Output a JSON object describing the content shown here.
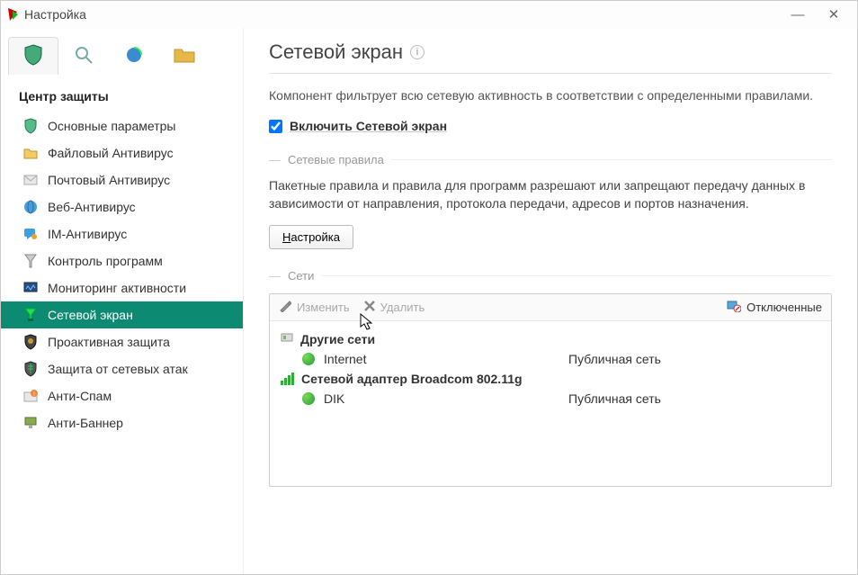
{
  "window": {
    "title": "Настройка"
  },
  "sidebar": {
    "section_title": "Центр защиты",
    "items": [
      {
        "label": "Основные параметры"
      },
      {
        "label": "Файловый Антивирус"
      },
      {
        "label": "Почтовый Антивирус"
      },
      {
        "label": "Веб-Антивирус"
      },
      {
        "label": "IM-Антивирус"
      },
      {
        "label": "Контроль программ"
      },
      {
        "label": "Мониторинг активности"
      },
      {
        "label": "Сетевой экран"
      },
      {
        "label": "Проактивная защита"
      },
      {
        "label": "Защита от сетевых атак"
      },
      {
        "label": "Анти-Спам"
      },
      {
        "label": "Анти-Баннер"
      }
    ]
  },
  "main": {
    "title": "Сетевой экран",
    "description": "Компонент фильтрует всю сетевую активность в соответствии с определенными правилами.",
    "enable_label": "Включить Сетевой экран",
    "rules_section": "Сетевые правила",
    "rules_description": "Пакетные правила и правила для программ разрешают или запрещают передачу данных в зависимости от направления, протокола передачи, адресов и портов назначения.",
    "settings_btn_prefix": "Н",
    "settings_btn_rest": "астройка",
    "networks_section": "Сети",
    "toolbar": {
      "edit": "Изменить",
      "delete": "Удалить",
      "disconnected": "Отключенные"
    },
    "networks": {
      "group1_title": "Другие сети",
      "group1_item_name": "Internet",
      "group1_item_type": "Публичная сеть",
      "group2_title": "Сетевой адаптер Broadcom 802.11g",
      "group2_item_name": "DIK",
      "group2_item_type": "Публичная сеть"
    }
  }
}
